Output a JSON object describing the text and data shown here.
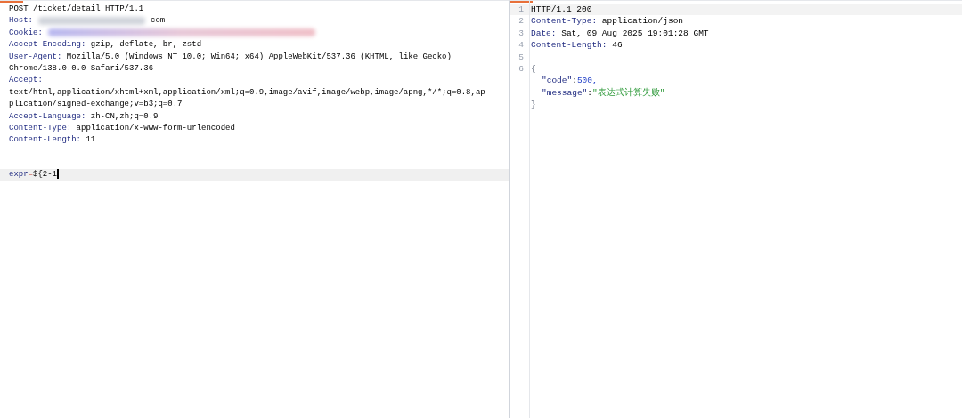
{
  "request": {
    "lines": [
      {
        "kind": "start",
        "text": "POST /ticket/detail HTTP/1.1"
      },
      {
        "kind": "header",
        "name": "Host:",
        "value": "com",
        "redacted": true
      },
      {
        "kind": "header",
        "name": "Cookie:",
        "redacted": true
      },
      {
        "kind": "header",
        "name": "Accept-Encoding:",
        "value": "gzip, deflate, br, zstd"
      },
      {
        "kind": "header",
        "name": "User-Agent:",
        "value": "Mozilla/5.0 (Windows NT 10.0; Win64; x64) AppleWebKit/537.36 (KHTML, like Gecko) Chrome/138.0.0.0 Safari/537.36"
      },
      {
        "kind": "header",
        "name": "Accept:",
        "value": "text/html,application/xhtml+xml,application/xml;q=0.9,image/avif,image/webp,image/apng,*/*;q=0.8,application/signed-exchange;v=b3;q=0.7"
      },
      {
        "kind": "header",
        "name": "Accept-Language:",
        "value": "zh-CN,zh;q=0.9"
      },
      {
        "kind": "header",
        "name": "Content-Type:",
        "value": "application/x-www-form-urlencoded"
      },
      {
        "kind": "header",
        "name": "Content-Length:",
        "value": "11"
      },
      {
        "kind": "blank"
      },
      {
        "kind": "param",
        "name": "expr",
        "separator": "=",
        "value": "${2-1",
        "current": true
      }
    ]
  },
  "response": {
    "lines": [
      {
        "kind": "start",
        "number": "1",
        "text": "HTTP/1.1 200",
        "current": true
      },
      {
        "kind": "header",
        "number": "2",
        "name": "Content-Type:",
        "value": "application/json"
      },
      {
        "kind": "header",
        "number": "3",
        "name": "Date:",
        "value": "Sat, 09 Aug 2025 19:01:28 GMT"
      },
      {
        "kind": "header",
        "number": "4",
        "name": "Content-Length:",
        "value": "46"
      },
      {
        "kind": "blank",
        "number": "5"
      },
      {
        "kind": "punct",
        "number": "6",
        "text": "{"
      },
      {
        "kind": "number_field",
        "key": "\"code\"",
        "colon": ":",
        "value": "500,"
      },
      {
        "kind": "string_field",
        "key": "\"message\"",
        "colon": ":",
        "value": "\"表达式计算失败\""
      },
      {
        "kind": "punct",
        "text": "}"
      }
    ]
  }
}
